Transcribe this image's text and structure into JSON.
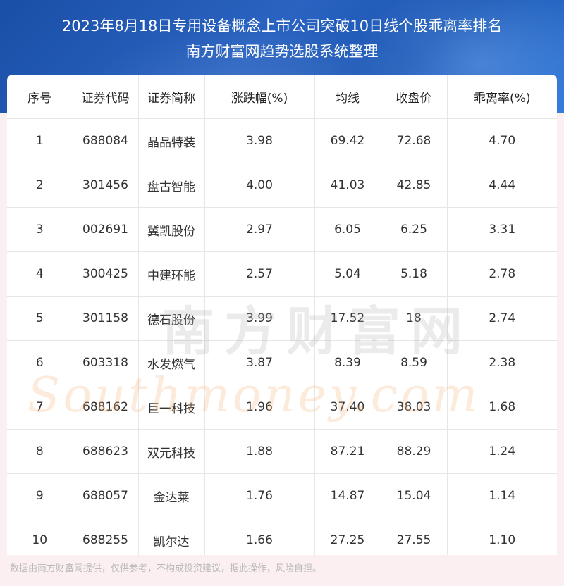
{
  "title": {
    "line1": "2023年8月18日专用设备概念上市公司突破10日线个股乖离率排名",
    "line2": "南方财富网趋势选股系统整理"
  },
  "table": {
    "headers": [
      "序号",
      "证券代码",
      "证券简称",
      "涨跌幅(%)",
      "均线",
      "收盘价",
      "乖离率(%)"
    ],
    "rows": [
      [
        "1",
        "688084",
        "晶品特装",
        "3.98",
        "69.42",
        "72.68",
        "4.70"
      ],
      [
        "2",
        "301456",
        "盘古智能",
        "4.00",
        "41.03",
        "42.85",
        "4.44"
      ],
      [
        "3",
        "002691",
        "冀凯股份",
        "2.97",
        "6.05",
        "6.25",
        "3.31"
      ],
      [
        "4",
        "300425",
        "中建环能",
        "2.57",
        "5.04",
        "5.18",
        "2.78"
      ],
      [
        "5",
        "301158",
        "德石股份",
        "3.99",
        "17.52",
        "18",
        "2.74"
      ],
      [
        "6",
        "603318",
        "水发燃气",
        "3.87",
        "8.39",
        "8.59",
        "2.38"
      ],
      [
        "7",
        "688162",
        "巨一科技",
        "1.96",
        "37.40",
        "38.03",
        "1.68"
      ],
      [
        "8",
        "688623",
        "双元科技",
        "1.88",
        "87.21",
        "88.29",
        "1.24"
      ],
      [
        "9",
        "688057",
        "金达莱",
        "1.76",
        "14.87",
        "15.04",
        "1.14"
      ],
      [
        "10",
        "688255",
        "凯尔达",
        "1.66",
        "27.25",
        "27.55",
        "1.10"
      ]
    ]
  },
  "watermark": {
    "cn": "南方财富网",
    "en": "Southmoney.com"
  },
  "footer": "数据由南方财富网提供，仅供参考，不构成投资建议，据此操作，风险自担。",
  "colors": {
    "banner": "#2a63c1",
    "background": "#fbeff2",
    "grid": "#e6e6e6",
    "text": "#333333"
  }
}
